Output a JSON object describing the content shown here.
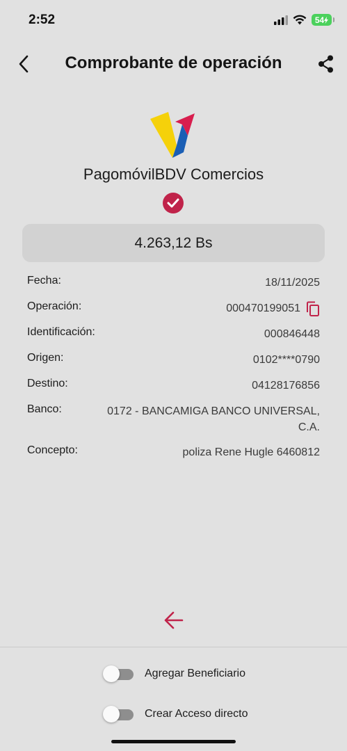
{
  "status_bar": {
    "time": "2:52",
    "battery": "54"
  },
  "header": {
    "title": "Comprobante de operación",
    "back_icon": "chevron-left-icon",
    "share_icon": "share-icon"
  },
  "brand": {
    "name": "PagomóvilBDV Comercios"
  },
  "amount": "4.263,12 Bs",
  "details": [
    {
      "label": "Fecha:",
      "value": "18/11/2025"
    },
    {
      "label": "Operación:",
      "value": "000470199051"
    },
    {
      "label": "Identificación:",
      "value": "000846448"
    },
    {
      "label": "Origen:",
      "value": "0102****0790"
    },
    {
      "label": "Destino:",
      "value": "04128176856"
    },
    {
      "label": "Banco:",
      "value": "0172 - BANCAMIGA BANCO UNIVERSAL, C.A."
    },
    {
      "label": "Concepto:",
      "value": "poliza Rene Hugle 6460812"
    }
  ],
  "toggles": [
    {
      "label": "Agregar Beneficiario",
      "on": false
    },
    {
      "label": "Crear Acceso directo",
      "on": false
    }
  ],
  "colors": {
    "accent": "#c0234a",
    "background": "#e1e1e1",
    "amount_box": "#d2d2d2",
    "battery": "#4bd15c"
  }
}
